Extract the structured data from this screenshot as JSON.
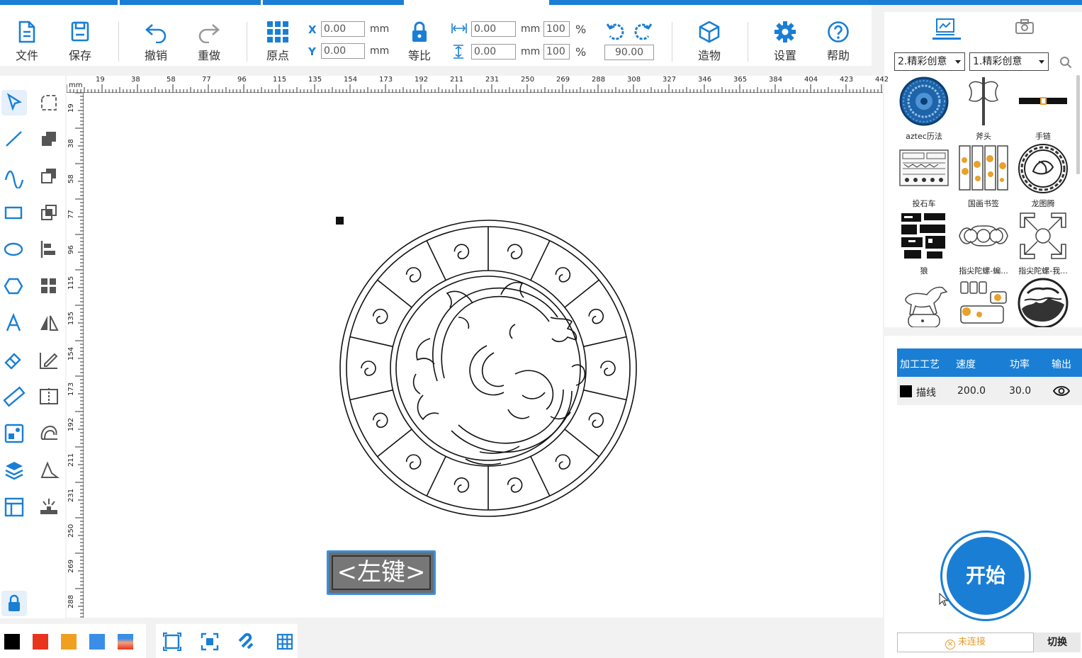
{
  "toolbar": {
    "file": "文件",
    "save": "保存",
    "undo": "撤销",
    "redo": "重做",
    "origin": "原点",
    "x_label": "X",
    "y_label": "Y",
    "x_value": "0.00",
    "y_value": "0.00",
    "mm": "mm",
    "lock_ratio": "等比",
    "width_value": "0.00",
    "height_value": "0.00",
    "width_pct": "100",
    "height_pct": "100",
    "pct": "%",
    "rotation": "90.00",
    "build": "造物",
    "settings": "设置",
    "help": "帮助"
  },
  "top_strip_colors": [
    "#1a7fd4",
    "#1a7fd4",
    "#1a7fd4",
    "#ffffff",
    "#1a7fd4"
  ],
  "library": {
    "category1": "2.精彩创意",
    "category2": "1.精彩创意",
    "items": [
      {
        "label": "aztec历法",
        "icon": "aztec-calendar"
      },
      {
        "label": "斧头",
        "icon": "axe"
      },
      {
        "label": "手链",
        "icon": "bracelet"
      },
      {
        "label": "投石车",
        "icon": "catapult"
      },
      {
        "label": "国画书签",
        "icon": "bookmark"
      },
      {
        "label": "龙图腾",
        "icon": "dragon-totem"
      },
      {
        "label": "狼",
        "icon": "wolf"
      },
      {
        "label": "指尖陀螺-蝙...",
        "icon": "fidget-spinner-bat"
      },
      {
        "label": "指尖陀螺-我...",
        "icon": "fidget-spinner-arrows"
      },
      {
        "label": "",
        "icon": "horse"
      },
      {
        "label": "",
        "icon": "animal-parts"
      },
      {
        "label": "",
        "icon": "landscape-medallion"
      }
    ]
  },
  "process_table": {
    "headers": [
      "加工工艺",
      "速度",
      "功率",
      "输出"
    ],
    "rows": [
      {
        "color": "#000000",
        "process": "描线",
        "speed": "200.0",
        "power": "30.0"
      }
    ]
  },
  "start_button": "开始",
  "connection_status": "未连接",
  "switch_button": "切换",
  "ruler": {
    "unit": "mm",
    "h_labels": [
      "19",
      "38",
      "58",
      "77",
      "96",
      "115",
      "135",
      "154",
      "173",
      "192",
      "211",
      "231",
      "250",
      "269",
      "288",
      "308",
      "327",
      "346",
      "365",
      "384",
      "404",
      "423",
      "442"
    ],
    "v_labels": [
      "19",
      "38",
      "58",
      "77",
      "96",
      "115",
      "135",
      "154",
      "173",
      "192",
      "211",
      "231",
      "250",
      "269",
      "288"
    ]
  },
  "key_hint": "<左键>",
  "palette_colors": [
    "#000000",
    "#e8341c",
    "#f0a020",
    "#3a8ee6"
  ]
}
